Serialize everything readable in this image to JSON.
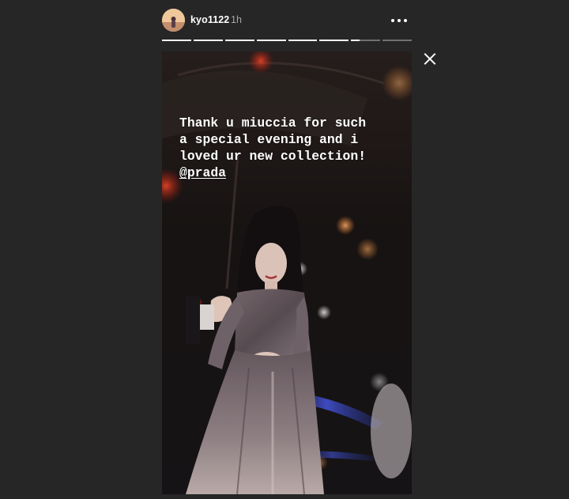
{
  "header": {
    "username": "kyo1122",
    "time": "1h",
    "more_icon": "more-horizontal-icon",
    "avatar_icon": "avatar"
  },
  "progress": {
    "segment_count": 8,
    "fills": [
      1,
      1,
      1,
      1,
      1,
      1,
      0.3,
      0
    ]
  },
  "close_icon": "close-icon",
  "story": {
    "caption_lines": [
      "Thank u miuccia for such",
      "a special evening and i",
      "loved ur new collection!"
    ],
    "mention": "@prada"
  },
  "colors": {
    "background": "#262626",
    "text": "#ffffff",
    "muted": "#a8a8a8"
  }
}
